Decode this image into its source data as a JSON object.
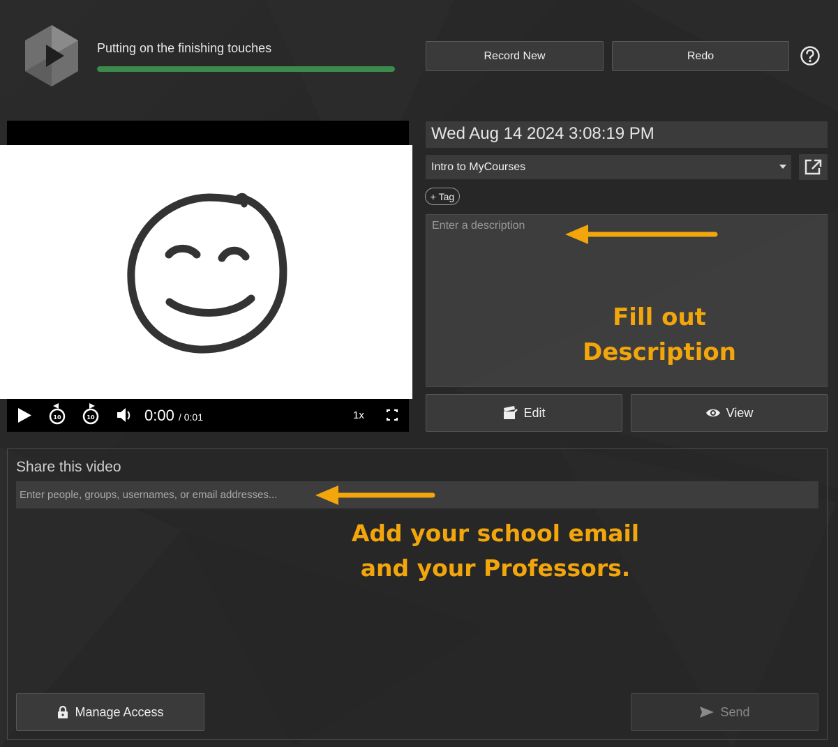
{
  "header": {
    "progress_label": "Putting on the finishing touches",
    "progress_fraction": 1.0,
    "record_new_label": "Record New",
    "redo_label": "Redo"
  },
  "player": {
    "current_time": "0:00",
    "duration": "/ 0:01",
    "speed": "1x"
  },
  "details": {
    "title": "Wed Aug 14 2024 3:08:19 PM",
    "folder": "Intro to MyCourses",
    "tag_label": "+ Tag",
    "description_placeholder": "Enter a description",
    "edit_label": "Edit",
    "view_label": "View"
  },
  "share": {
    "title": "Share this video",
    "input_placeholder": "Enter people, groups, usernames, or email addresses...",
    "manage_access_label": "Manage Access",
    "send_label": "Send"
  },
  "annotations": {
    "description_line1": "Fill out",
    "description_line2": "Description",
    "share_line1": "Add your school email",
    "share_line2": "and your Professors.",
    "color": "#f2a60c"
  },
  "colors": {
    "background": "#272727",
    "progress": "#3c8a4c",
    "button": "#3a3a3a"
  }
}
